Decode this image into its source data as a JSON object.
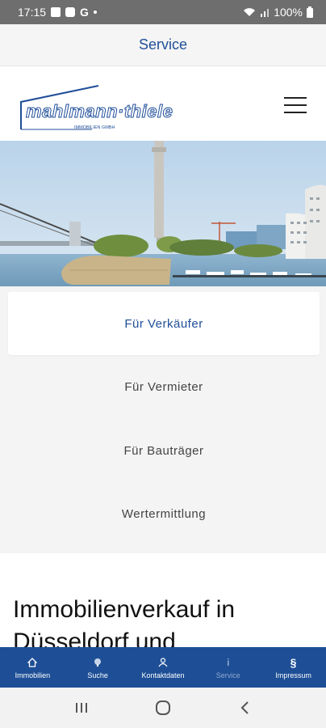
{
  "status_bar": {
    "time": "17:15",
    "g_letter": "G",
    "battery": "100%"
  },
  "top_bar": {
    "title": "Service"
  },
  "logo": {
    "brand": "mahlmann·thiele",
    "subline": "IMMOBILIEN GMBH"
  },
  "menu": {
    "items": [
      {
        "label": "Für Verkäufer",
        "active": true
      },
      {
        "label": "Für Vermieter",
        "active": false
      },
      {
        "label": "Für Bauträger",
        "active": false
      },
      {
        "label": "Wertermittlung",
        "active": false
      }
    ]
  },
  "content": {
    "heading": "Immobilienverkauf in Düsseldorf und"
  },
  "tab_bar": {
    "tabs": [
      {
        "label": "Immobilien",
        "icon": "home-icon"
      },
      {
        "label": "Suche",
        "icon": "search-icon"
      },
      {
        "label": "Kontaktdaten",
        "icon": "contact-icon"
      },
      {
        "label": "Service",
        "icon": "info-icon",
        "selected": true
      },
      {
        "label": "Impressum",
        "icon": "paragraph-icon"
      }
    ]
  },
  "colors": {
    "brand_blue": "#1f4e99",
    "tab_bar": "#1e4f96",
    "status_bar": "#6e6e6e"
  }
}
